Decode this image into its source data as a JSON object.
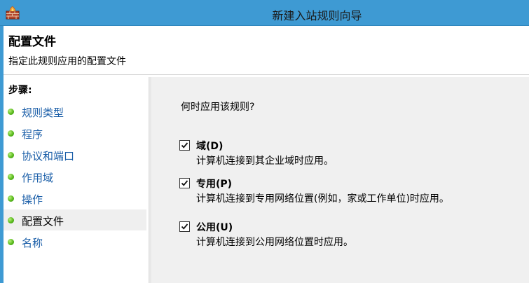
{
  "window": {
    "title": "新建入站规则向导",
    "icon": "firewall-wall-icon"
  },
  "header": {
    "title": "配置文件",
    "subtitle": "指定此规则应用的配置文件"
  },
  "sidebar": {
    "steps_label": "步骤:",
    "items": [
      {
        "label": "规则类型",
        "active": false
      },
      {
        "label": "程序",
        "active": false
      },
      {
        "label": "协议和端口",
        "active": false
      },
      {
        "label": "作用域",
        "active": false
      },
      {
        "label": "操作",
        "active": false
      },
      {
        "label": "配置文件",
        "active": true
      },
      {
        "label": "名称",
        "active": false
      }
    ]
  },
  "main": {
    "question": "何时应用该规则?",
    "options": [
      {
        "label": "域(D)",
        "description": "计算机连接到其企业域时应用。",
        "checked": true
      },
      {
        "label": "专用(P)",
        "description": "计算机连接到专用网络位置(例如，家或工作单位)时应用。",
        "checked": true
      },
      {
        "label": "公用(U)",
        "description": "计算机连接到公用网络位置时应用。",
        "checked": true
      }
    ]
  },
  "colors": {
    "titlebar": "#3e9ad3",
    "link": "#1a5ea8",
    "content_bg": "#f0f0f0",
    "bullet": "#59b91c"
  }
}
